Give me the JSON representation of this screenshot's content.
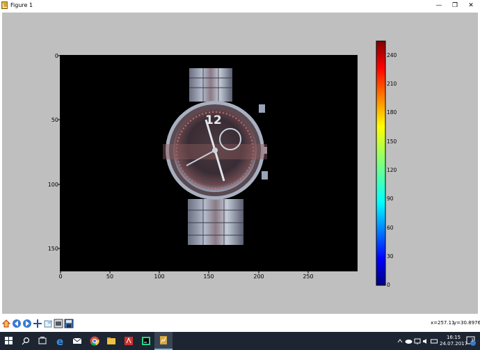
{
  "window": {
    "title": "Figure 1",
    "minimize_symbol": "—",
    "restore_symbol": "❐",
    "close_symbol": "✕"
  },
  "plot": {
    "x_ticks": [
      "0",
      "50",
      "100",
      "150",
      "200",
      "250"
    ],
    "y_ticks": [
      "0",
      "50",
      "100",
      "150"
    ],
    "colorbar_ticks": [
      "0",
      "30",
      "60",
      "90",
      "120",
      "150",
      "180",
      "210",
      "240"
    ],
    "image_subject": "watch"
  },
  "toolbar": {
    "buttons": [
      {
        "name": "home-icon"
      },
      {
        "name": "back-icon"
      },
      {
        "name": "forward-icon"
      },
      {
        "name": "pan-icon"
      },
      {
        "name": "zoom-icon"
      },
      {
        "name": "subplots-icon"
      },
      {
        "name": "save-icon"
      }
    ],
    "x_readout": "x=257.11",
    "y_readout": "y=30.8976"
  },
  "taskbar": {
    "apps": [
      "start-icon",
      "search-icon",
      "task-view-icon",
      "edge-icon",
      "mail-icon",
      "chrome-icon",
      "explorer-icon",
      "pdf-icon",
      "pycharm-icon",
      "python-figure-icon"
    ],
    "time": "16:15",
    "date": "24.07.2017",
    "notification_count": "3"
  },
  "colors": {
    "figure_bg": "#bfbfbf",
    "taskbar_bg": "#1d2533",
    "accent": "#0078d7"
  }
}
